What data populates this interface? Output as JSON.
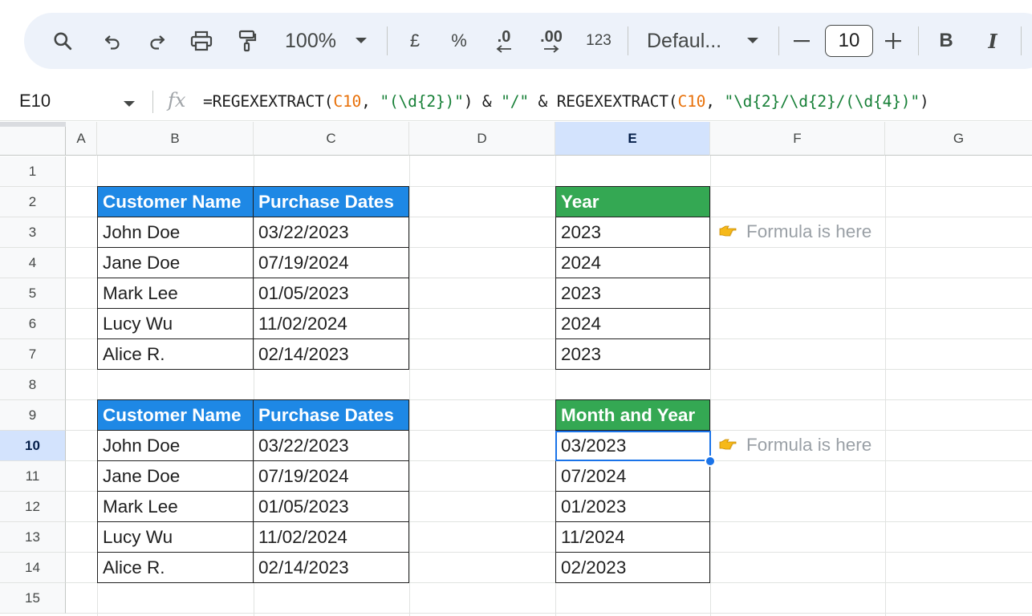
{
  "toolbar": {
    "zoom": "100%",
    "currency": "£",
    "percent": "%",
    "decrease_decimal": ".0",
    "increase_decimal": ".00",
    "number_format": "123",
    "font": "Defaul...",
    "font_size": "10",
    "bold": "B",
    "italic": "I"
  },
  "formula_bar": {
    "cell_ref": "E10",
    "fx": "fx",
    "formula_parts": {
      "p1": "=REGEXEXTRACT(",
      "r1": "C10",
      "p2": ", ",
      "s1": "\"(\\d{2})\"",
      "p3": ") & ",
      "s2": "\"/\"",
      "p4": " & REGEXEXTRACT(",
      "r2": "C10",
      "p5": ", ",
      "s3": "\"\\d{2}/\\d{2}/(\\d{4})\"",
      "p6": ")"
    }
  },
  "columns": [
    "A",
    "B",
    "C",
    "D",
    "E",
    "F",
    "G"
  ],
  "rows": [
    "1",
    "2",
    "3",
    "4",
    "5",
    "6",
    "7",
    "8",
    "9",
    "10",
    "11",
    "12",
    "13",
    "14",
    "15"
  ],
  "active_column": "E",
  "active_row": "10",
  "table1": {
    "headers": [
      "Customer Name",
      "Purchase Dates"
    ],
    "rows": [
      [
        "John Doe",
        "03/22/2023"
      ],
      [
        "Jane Doe",
        "07/19/2024"
      ],
      [
        "Mark Lee",
        "01/05/2023"
      ],
      [
        "Lucy Wu",
        "11/02/2024"
      ],
      [
        "Alice R.",
        "02/14/2023"
      ]
    ]
  },
  "year_table": {
    "header": "Year",
    "values": [
      "2023",
      "2024",
      "2023",
      "2024",
      "2023"
    ]
  },
  "table2": {
    "headers": [
      "Customer Name",
      "Purchase Dates"
    ],
    "rows": [
      [
        "John Doe",
        "03/22/2023"
      ],
      [
        "Jane Doe",
        "07/19/2024"
      ],
      [
        "Mark Lee",
        "01/05/2023"
      ],
      [
        "Lucy Wu",
        "11/02/2024"
      ],
      [
        "Alice R.",
        "02/14/2023"
      ]
    ]
  },
  "month_year_table": {
    "header": "Month and Year",
    "values": [
      "03/2023",
      "07/2024",
      "01/2023",
      "11/2024",
      "02/2023"
    ]
  },
  "notes": {
    "note1": "Formula is here",
    "note2": "Formula is here"
  },
  "colors": {
    "blue_header": "#1e88e5",
    "green_header": "#34a853",
    "selection": "#1a73e8"
  }
}
